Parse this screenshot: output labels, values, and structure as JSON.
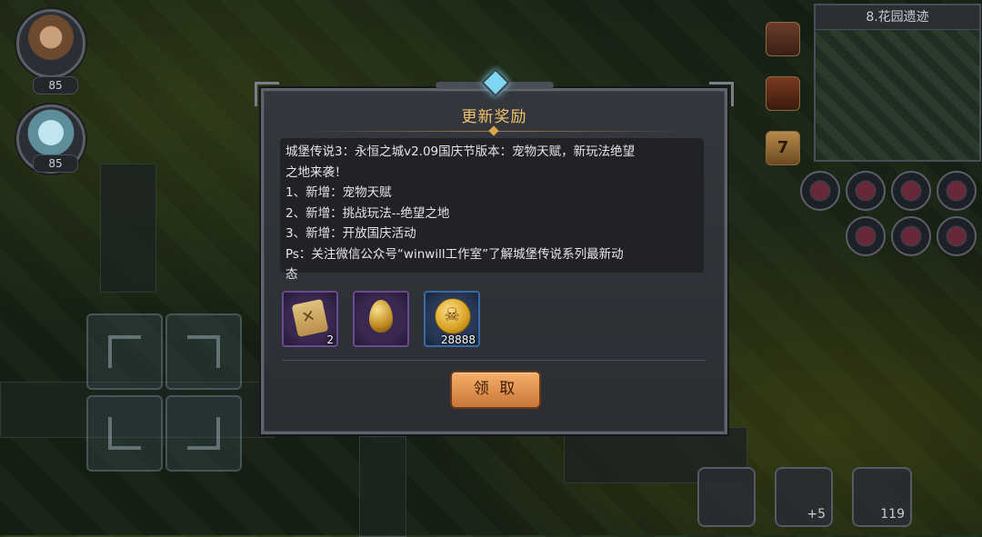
{
  "heroes": [
    {
      "level": "85"
    },
    {
      "level": "85"
    }
  ],
  "minimap": {
    "title": "8.花园遗迹"
  },
  "side_badge": {
    "value": "7"
  },
  "bottom_buttons": {
    "auto_bonus": "+5",
    "resource_count": "119"
  },
  "dialog": {
    "title": "更新奖励",
    "lines": [
      "城堡传说3：永恒之城v2.09国庆节版本：宠物天赋，新玩法绝望",
      "之地来袭！",
      "1、新增：宠物天赋",
      "2、新增：挑战玩法--绝望之地",
      "3、新增：开放国庆活动",
      "Ps：关注微信公众号“winwill工作室”了解城堡传说系列最新动",
      "态"
    ],
    "rewards": [
      {
        "icon": "scroll-icon",
        "qty": "2"
      },
      {
        "icon": "golden-egg-icon",
        "qty": ""
      },
      {
        "icon": "gold-coin-icon",
        "qty": "28888"
      }
    ],
    "claim_label": "领 取"
  },
  "colors": {
    "title": "#f3c46b",
    "claim_button": "#e8964f",
    "dialog_bg": "#2f3237"
  }
}
